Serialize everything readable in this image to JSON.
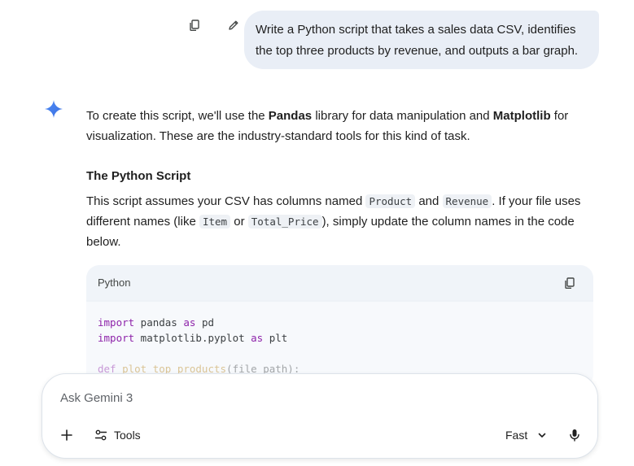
{
  "user_message": {
    "line1": "Write a Python script that takes a sales data CSV, identifies",
    "line2": "the top three products by revenue, and outputs a bar graph."
  },
  "response": {
    "intro_part1": "To create this script, we'll use the ",
    "intro_bold1": "Pandas",
    "intro_part2": " library for data manipulation and ",
    "intro_bold2": "Matplotlib",
    "intro_part3": " for visualization. These are the industry-standard tools for this kind of task.",
    "heading": "The Python Script",
    "para_part1": "This script assumes your CSV has columns named ",
    "code1": "Product",
    "para_part2": " and ",
    "code2": "Revenue",
    "para_part3": ". If your file uses different names (like ",
    "code3": "Item",
    "para_part4": " or ",
    "code4": "Total_Price",
    "para_part5": "), simply update the column names in the code below."
  },
  "code_block": {
    "language": "Python",
    "line1_kw": "import",
    "line1_rest": " pandas ",
    "line1_as": "as",
    "line1_alias": " pd",
    "line2_kw": "import",
    "line2_rest": " matplotlib.pyplot ",
    "line2_as": "as",
    "line2_alias": " plt",
    "line3_kw": "def",
    "line3_fn": " plot_top_products",
    "line3_rest": "(file_path):"
  },
  "composer": {
    "placeholder": "Ask Gemini 3",
    "tools_label": "Tools",
    "mode_label": "Fast"
  },
  "colors": {
    "user_bubble": "#e9eef6",
    "code_header_bg": "#f0f4f9",
    "keyword": "#8e24aa",
    "function_name": "#b8861b",
    "sparkle": "#4285f4"
  }
}
